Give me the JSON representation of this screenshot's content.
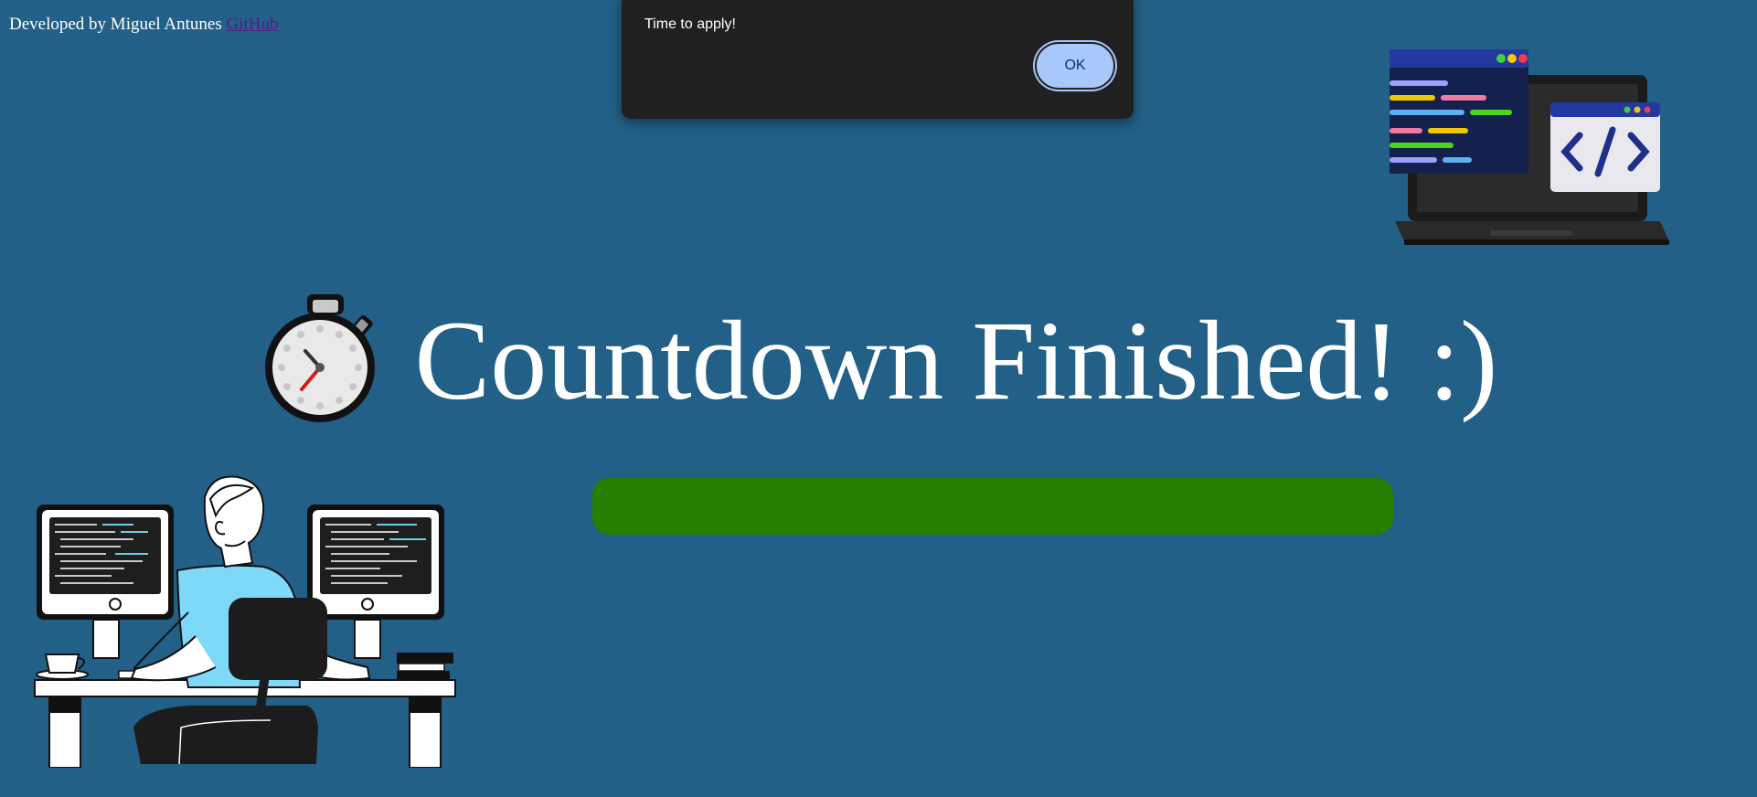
{
  "credit": {
    "text": "Developed by Miguel Antunes ",
    "link_label": "GitHub"
  },
  "alert": {
    "title": "",
    "message": "Time to apply!",
    "ok_label": "OK"
  },
  "main": {
    "heading": "Countdown Finished! :)",
    "progress_fraction": 1.0,
    "progress_color": "#268000"
  },
  "colors": {
    "background": "#236087",
    "dialog_bg": "#202020",
    "ok_button": "#a8c7fa"
  },
  "icons": [
    "stopwatch-icon",
    "laptop-code-illustration",
    "developer-desk-illustration"
  ]
}
